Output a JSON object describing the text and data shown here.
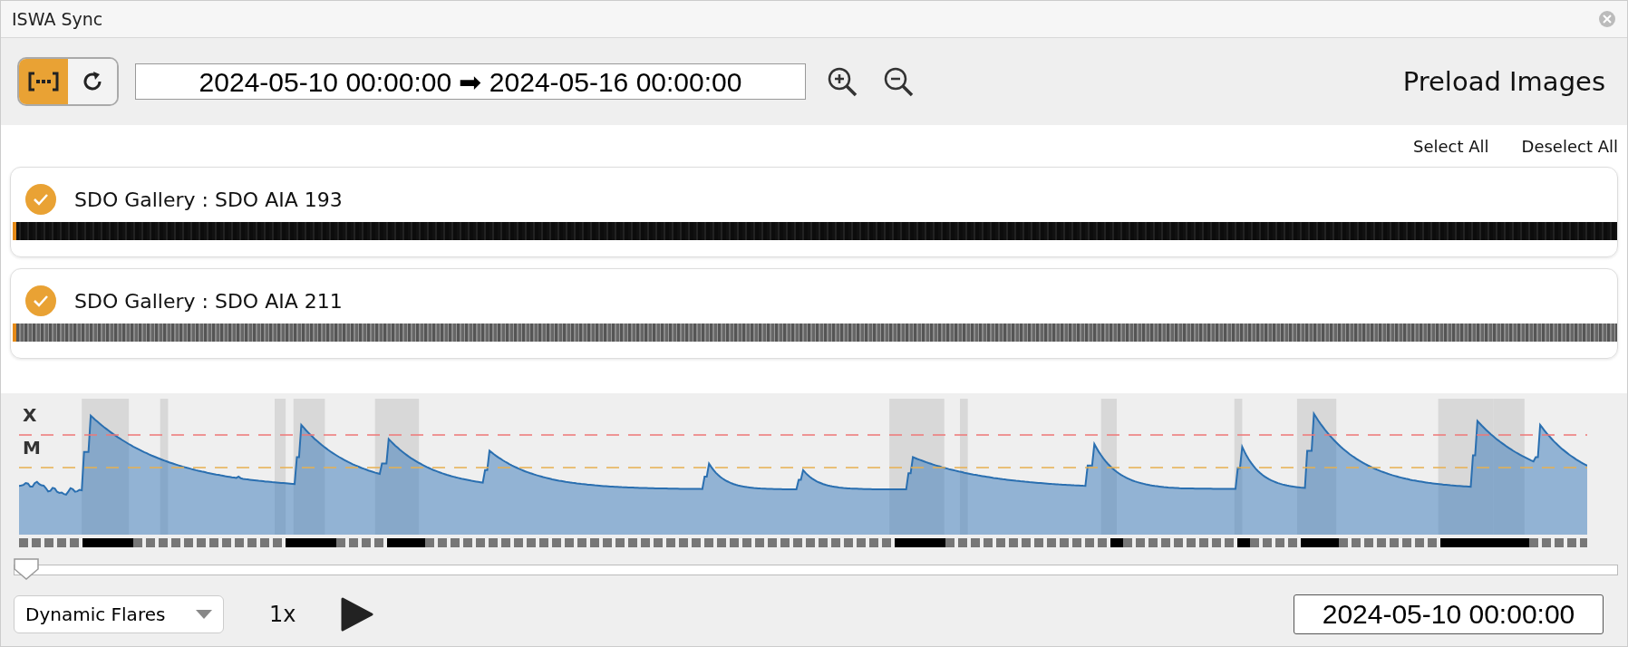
{
  "window": {
    "title": "ISWA Sync"
  },
  "toolbar": {
    "range_toggle": {
      "on": true
    },
    "date_range": "2024-05-10 00:00:00 ➡ 2024-05-16 00:00:00",
    "preload": "Preload Images"
  },
  "selection": {
    "select_all": "Select All",
    "deselect_all": "Deselect All"
  },
  "channels": [
    {
      "label": "SDO Gallery : SDO AIA 193",
      "checked": true,
      "kind": "dark"
    },
    {
      "label": "SDO Gallery : SDO AIA 211",
      "checked": true,
      "kind": "grey"
    }
  ],
  "flux_plot": {
    "levels": [
      "X",
      "M"
    ]
  },
  "timeline": {
    "level": 0
  },
  "controls": {
    "mode": "Dynamic Flares",
    "speed": "1x",
    "current_time": "2024-05-10 00:00:00"
  }
}
